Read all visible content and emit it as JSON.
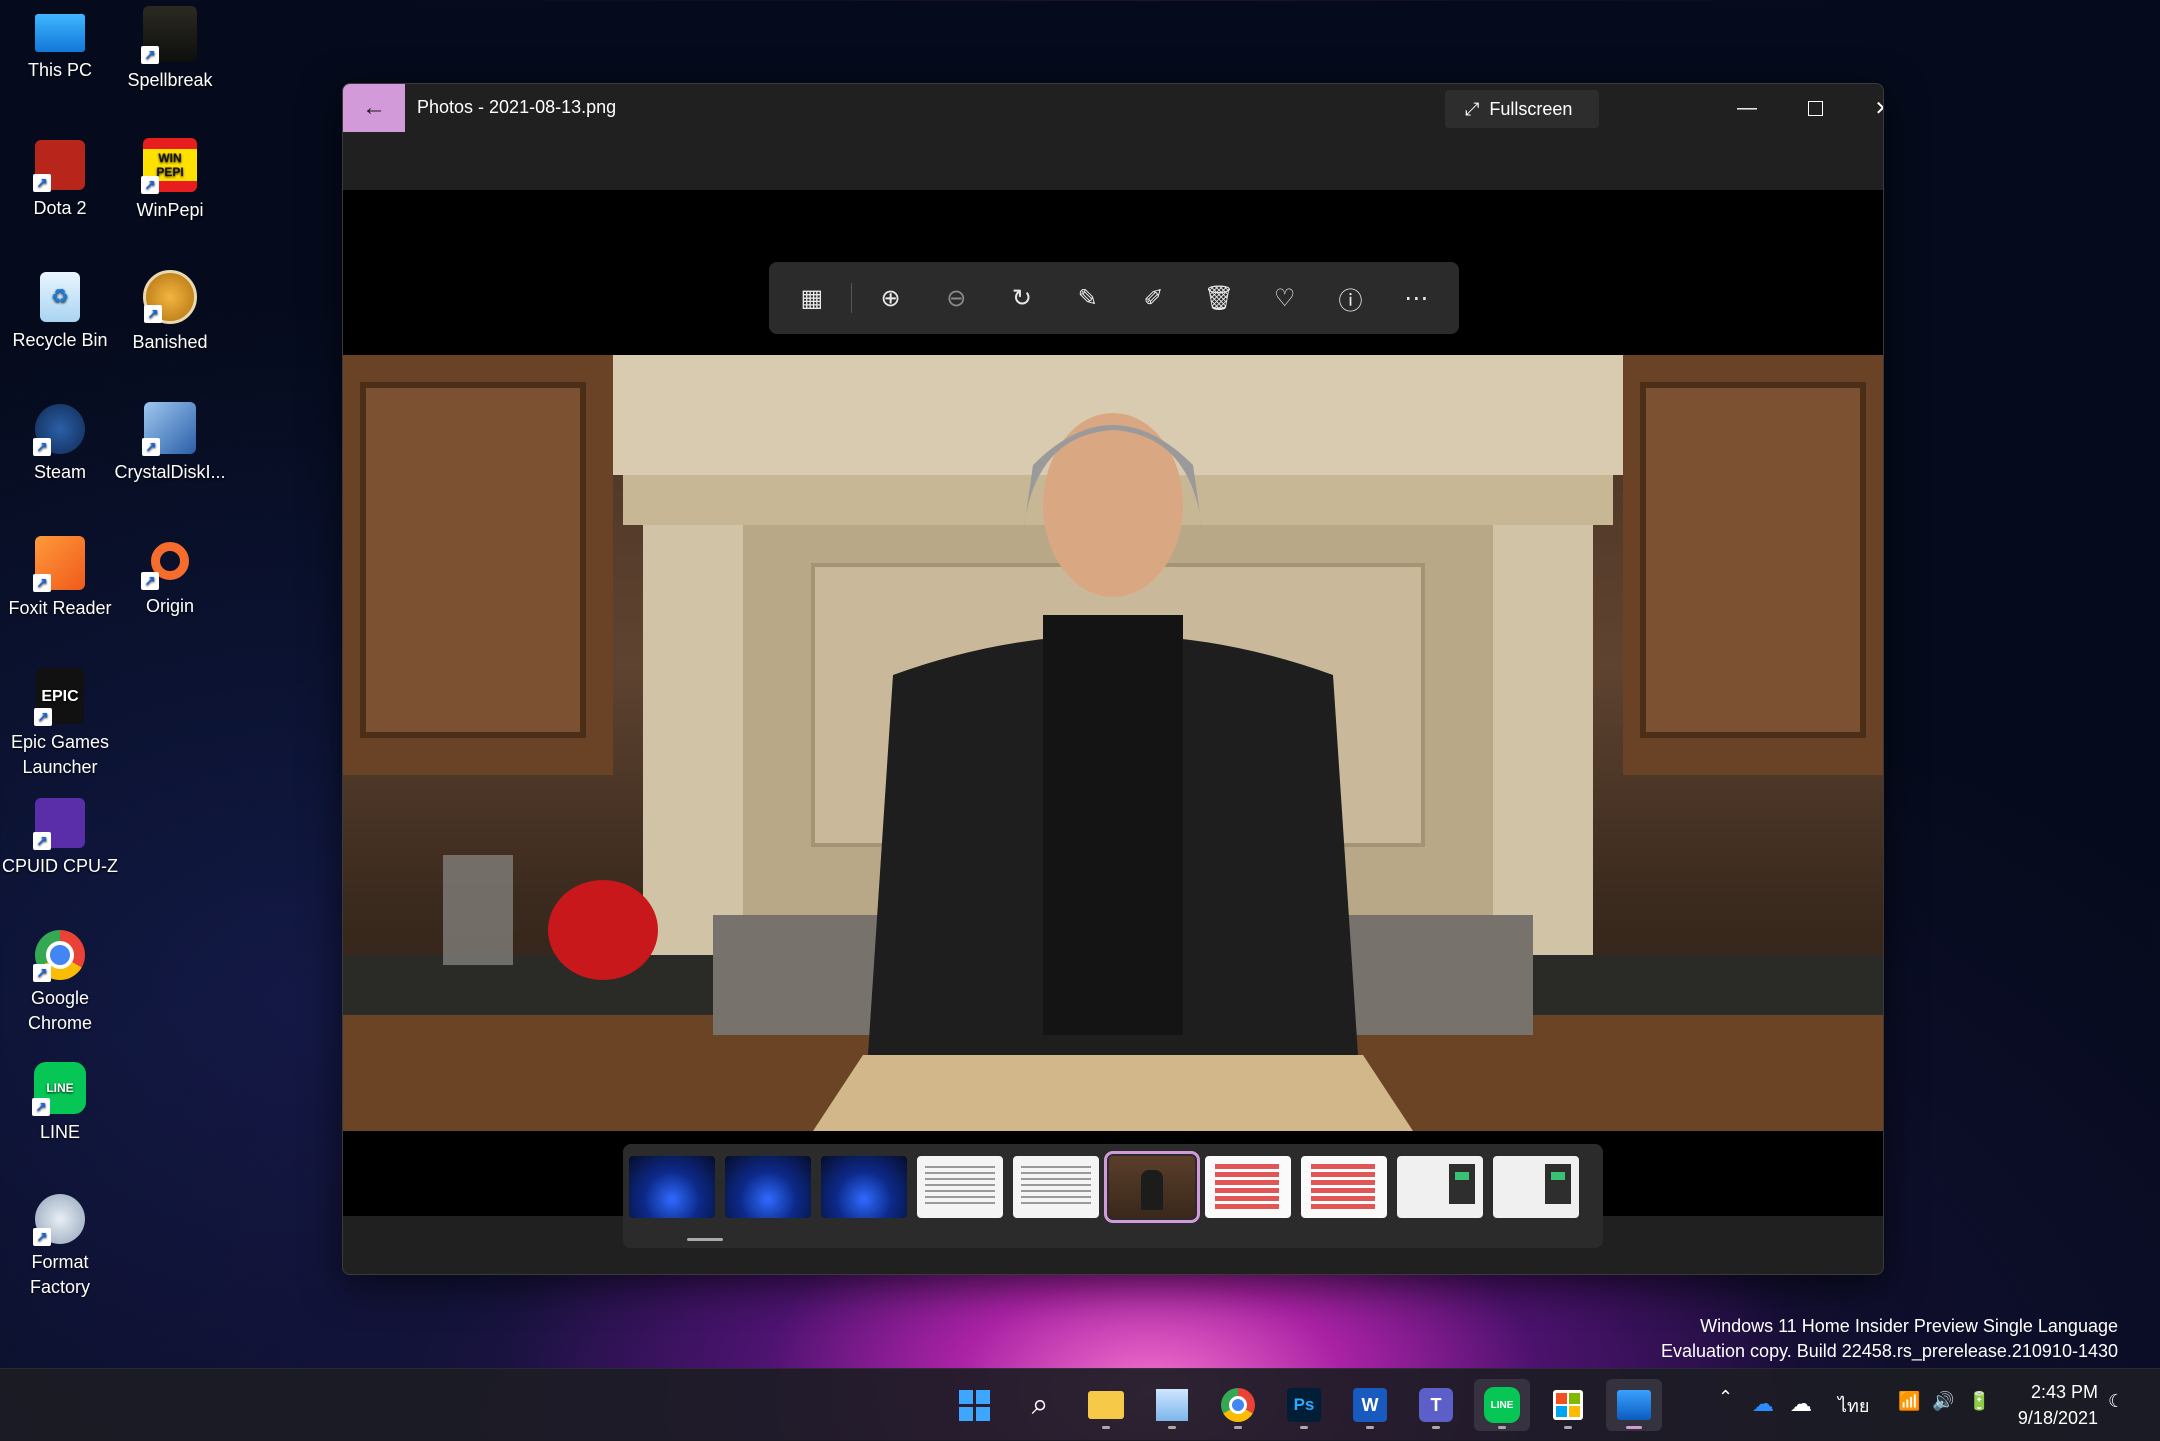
{
  "desktop": {
    "icons": [
      {
        "label": "This PC",
        "icon": "this-pc-icon"
      },
      {
        "label": "Spellbreak",
        "icon": "spellbreak-icon"
      },
      {
        "label": "Dota 2",
        "icon": "dota2-icon"
      },
      {
        "label": "WinPepi",
        "icon": "winpepi-icon",
        "badge": "WIN PEPI"
      },
      {
        "label": "Recycle Bin",
        "icon": "recycle-bin-icon"
      },
      {
        "label": "Banished",
        "icon": "banished-icon"
      },
      {
        "label": "Steam",
        "icon": "steam-icon"
      },
      {
        "label": "CrystalDiskI...",
        "icon": "crystaldiskinfo-icon"
      },
      {
        "label": "Foxit Reader",
        "icon": "foxit-reader-icon"
      },
      {
        "label": "Origin",
        "icon": "origin-icon"
      },
      {
        "label": "Epic Games Launcher",
        "icon": "epic-games-icon",
        "badge": "EPIC"
      },
      {
        "label": "CPUID CPU-Z",
        "icon": "cpuz-icon"
      },
      {
        "label": "Google Chrome",
        "icon": "chrome-icon"
      },
      {
        "label": "LINE",
        "icon": "line-icon",
        "badge": "LINE"
      },
      {
        "label": "Format Factory",
        "icon": "format-factory-icon"
      }
    ]
  },
  "window": {
    "title": "Photos - 2021-08-13.png",
    "fullscreen_label": "Fullscreen",
    "accent": "#d39ad9",
    "toolbar": [
      {
        "name": "gallery-button",
        "icon": "gallery-icon"
      },
      {
        "name": "zoom-in-button",
        "icon": "zoom-in-icon"
      },
      {
        "name": "zoom-out-button",
        "icon": "zoom-out-icon"
      },
      {
        "name": "rotate-button",
        "icon": "rotate-icon"
      },
      {
        "name": "edit-image-button",
        "icon": "edit-image-icon"
      },
      {
        "name": "draw-button",
        "icon": "pen-icon"
      },
      {
        "name": "delete-button",
        "icon": "trash-icon"
      },
      {
        "name": "favorite-button",
        "icon": "heart-icon"
      },
      {
        "name": "info-button",
        "icon": "info-icon"
      },
      {
        "name": "more-button",
        "icon": "more-icon"
      }
    ],
    "filmstrip": [
      {
        "kind": "blue"
      },
      {
        "kind": "blue"
      },
      {
        "kind": "blue"
      },
      {
        "kind": "doc"
      },
      {
        "kind": "doc"
      },
      {
        "kind": "photo-t",
        "selected": true
      },
      {
        "kind": "red"
      },
      {
        "kind": "red"
      },
      {
        "kind": "app"
      },
      {
        "kind": "app"
      }
    ]
  },
  "watermark": {
    "line1": "Windows 11 Home Insider Preview Single Language",
    "line2": "Evaluation copy. Build 22458.rs_prerelease.210910-1430"
  },
  "taskbar": {
    "apps": [
      {
        "name": "start",
        "icon": "windows-start-icon"
      },
      {
        "name": "search",
        "icon": "search-icon"
      },
      {
        "name": "file-explorer",
        "icon": "folder-icon"
      },
      {
        "name": "image-viewer",
        "icon": "image-app-icon"
      },
      {
        "name": "chrome",
        "icon": "chrome-icon"
      },
      {
        "name": "photoshop",
        "icon": "photoshop-icon",
        "text": "Ps"
      },
      {
        "name": "word",
        "icon": "word-icon",
        "text": "W"
      },
      {
        "name": "teams",
        "icon": "teams-icon",
        "text": "T"
      },
      {
        "name": "line",
        "icon": "line-icon",
        "text": "LINE"
      },
      {
        "name": "store",
        "icon": "store-icon"
      },
      {
        "name": "photos",
        "icon": "photos-icon",
        "active": true
      }
    ],
    "tray": {
      "language": "ไทย",
      "time": "2:43 PM",
      "date": "9/18/2021"
    }
  }
}
